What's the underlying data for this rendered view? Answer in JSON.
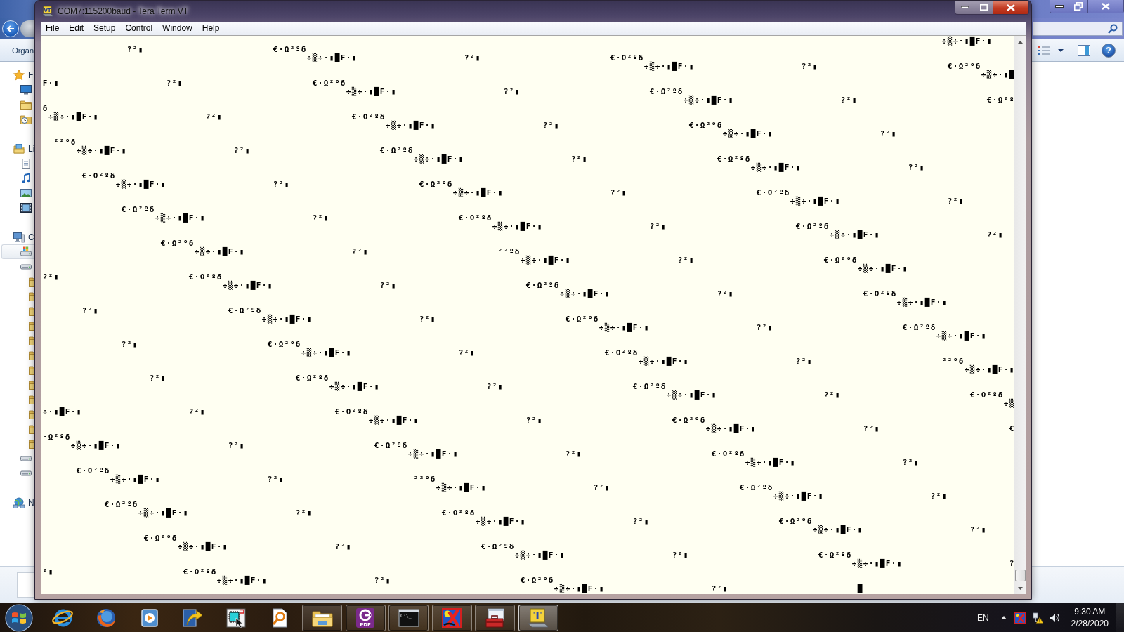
{
  "explorer": {
    "toolbar_label": "Organ",
    "help_text": "?",
    "nav": [
      {
        "label": "F",
        "children": [
          {
            "selected": false
          },
          {
            "selected": false
          },
          {
            "selected": false
          }
        ]
      },
      {
        "label": "Li",
        "children": [
          {
            "selected": false
          },
          {
            "selected": false
          },
          {
            "selected": false
          },
          {
            "selected": false
          }
        ]
      },
      {
        "label": "C",
        "children": [
          {
            "selected": true
          },
          {
            "selected": false,
            "children": [
              {
                "selected": false
              },
              {
                "selected": false
              },
              {
                "selected": false
              },
              {
                "selected": false
              },
              {
                "selected": false
              },
              {
                "selected": false
              },
              {
                "selected": false
              },
              {
                "selected": false
              },
              {
                "selected": false
              },
              {
                "selected": false
              },
              {
                "selected": false
              },
              {
                "selected": false
              }
            ]
          },
          {
            "selected": false
          },
          {
            "selected": false
          }
        ]
      },
      {
        "label": "N"
      }
    ]
  },
  "window": {
    "title": "COM7:115200baud - Tera Term VT",
    "icon_text": "VT",
    "menu": [
      "File",
      "Edit",
      "Setup",
      "Control",
      "Window",
      "Help"
    ]
  },
  "terminal": {
    "lines": [
      [
        "                                                                                                                                                                ÷▒÷·▮█F·▮"
      ],
      [
        "               ?²▮",
        "                       €·Ω²ºδ"
      ],
      [
        "                                               ÷▒÷·▮█F·▮",
        "                   ?²▮",
        "                       €·Ω²ºδ"
      ],
      [
        "                                                                                                           ÷▒÷·▮█F·▮",
        "                   ?²▮",
        "                       €·Ω²ºδ"
      ],
      [
        "                                                                                                                                                                       ÷▒÷·▮█"
      ],
      [
        "F·▮",
        "                   ?²▮",
        "                       €·Ω²ºδ"
      ],
      [
        "                                                      ÷▒÷·▮█F·▮",
        "                   ?²▮",
        "                       €·Ω²ºδ"
      ],
      [
        "                                                                                                                  ÷▒÷·▮█F·▮",
        "                   ?²▮",
        "                       €·Ω²º"
      ],
      [
        "δ"
      ],
      [
        " ÷▒÷·▮█F·▮",
        "                   ?²▮",
        "                       €·Ω²ºδ"
      ],
      [
        "                                                             ÷▒÷·▮█F·▮",
        "                   ?²▮",
        "                       €·Ω²ºδ"
      ],
      [
        "                                                                                                                         ÷▒÷·▮█F·▮",
        "                   ?²▮"
      ],
      [
        "  ²²ºδ"
      ],
      [
        "      ÷▒÷·▮█F·▮",
        "                   ?²▮",
        "                       €·Ω²ºδ"
      ],
      [
        "                                                                  ÷▒÷·▮█F·▮",
        "                   ?²▮",
        "                       €·Ω²ºδ"
      ],
      [
        "                                                                                                                              ÷▒÷·▮█F·▮",
        "                   ?²▮"
      ],
      [
        "       €·Ω²ºδ"
      ],
      [
        "             ÷▒÷·▮█F·▮",
        "                   ?²▮",
        "                       €·Ω²ºδ"
      ],
      [
        "                                                                         ÷▒÷·▮█F·▮",
        "                   ?²▮",
        "                       €·Ω²ºδ"
      ],
      [
        "                                                                                                                                     ÷▒÷·▮█F·▮",
        "                   ?²▮"
      ],
      [
        "              €·Ω²ºδ"
      ],
      [
        "                    ÷▒÷·▮█F·▮",
        "                   ?²▮",
        "                       €·Ω²ºδ"
      ],
      [
        "                                                                                ÷▒÷·▮█F·▮",
        "                   ?²▮",
        "                       €·Ω²ºδ"
      ],
      [
        "                                                                                                                                            ÷▒÷·▮█F·▮",
        "                   ?²▮"
      ],
      [
        "                     €·Ω²ºδ"
      ],
      [
        "                           ÷▒÷·▮█F·▮",
        "                   ?²▮",
        "                       ²²ºδ"
      ],
      [
        "                                                                                     ÷▒÷·▮█F·▮",
        "                   ?²▮",
        "                       €·Ω²ºδ"
      ],
      [
        "                                                                                                                                                 ÷▒÷·▮█F·▮"
      ],
      [
        "?²▮",
        "                       €·Ω²ºδ"
      ],
      [
        "                                ÷▒÷·▮█F·▮",
        "                   ?²▮",
        "                       €·Ω²ºδ"
      ],
      [
        "                                                                                            ÷▒÷·▮█F·▮",
        "                   ?²▮",
        "                       €·Ω²ºδ"
      ],
      [
        "                                                                                                                                                        ÷▒÷·▮█F·▮"
      ],
      [
        "       ?²▮",
        "                       €·Ω²ºδ"
      ],
      [
        "                                       ÷▒÷·▮█F·▮",
        "                   ?²▮",
        "                       €·Ω²ºδ"
      ],
      [
        "                                                                                                   ÷▒÷·▮█F·▮",
        "                   ?²▮",
        "                       €·Ω²ºδ"
      ],
      [
        "                                                                                                                                                               ÷▒÷·▮█F·▮"
      ],
      [
        "              ?²▮",
        "                       €·Ω²ºδ"
      ],
      [
        "                                              ÷▒÷·▮█F·▮",
        "                   ?²▮",
        "                       €·Ω²ºδ"
      ],
      [
        "                                                                                                          ÷▒÷·▮█F·▮",
        "                   ?²▮",
        "                       ²²ºδ"
      ],
      [
        "                                                                                                                                                                    ÷▒÷·▮█F·▮"
      ],
      [
        "                   ?²▮",
        "                       €·Ω²ºδ"
      ],
      [
        "                                                   ÷▒÷·▮█F·▮",
        "                   ?²▮",
        "                       €·Ω²ºδ"
      ],
      [
        "                                                                                                               ÷▒÷·▮█F·▮",
        "                   ?²▮",
        "                       €·Ω²ºδ"
      ],
      [
        "                                                                                                                                                                           ÷▒"
      ],
      [
        "÷·▮█F·▮",
        "                   ?²▮",
        "                       €·Ω²ºδ"
      ],
      [
        "                                                          ÷▒÷·▮█F·▮",
        "                   ?²▮",
        "                       €·Ω²ºδ"
      ],
      [
        "                                                                                                                      ÷▒÷·▮█F·▮",
        "                   ?²▮",
        "                       €"
      ],
      [
        "·Ω²ºδ"
      ],
      [
        "     ÷▒÷·▮█F·▮",
        "                   ?²▮",
        "                       €·Ω²ºδ"
      ],
      [
        "                                                                 ÷▒÷·▮█F·▮",
        "                   ?²▮",
        "                       €·Ω²ºδ"
      ],
      [
        "                                                                                                                             ÷▒÷·▮█F·▮",
        "                   ?²▮"
      ],
      [
        "      €·Ω²ºδ"
      ],
      [
        "            ÷▒÷·▮█F·▮",
        "                   ?²▮",
        "                       ²²ºδ"
      ],
      [
        "                                                                      ÷▒÷·▮█F·▮",
        "                   ?²▮",
        "                       €·Ω²ºδ"
      ],
      [
        "                                                                                                                                  ÷▒÷·▮█F·▮",
        "                   ?²▮"
      ],
      [
        "           €·Ω²ºδ"
      ],
      [
        "                 ÷▒÷·▮█F·▮",
        "                   ?²▮",
        "                       €·Ω²ºδ"
      ],
      [
        "                                                                             ÷▒÷·▮█F·▮",
        "                   ?²▮",
        "                       €·Ω²ºδ"
      ],
      [
        "                                                                                                                                         ÷▒÷·▮█F·▮",
        "                   ?²▮"
      ],
      [
        "                  €·Ω²ºδ"
      ],
      [
        "                        ÷▒÷·▮█F·▮",
        "                   ?²▮",
        "                       €·Ω²ºδ"
      ],
      [
        "                                                                                    ÷▒÷·▮█F·▮",
        "                   ?²▮",
        "                       €·Ω²ºδ"
      ],
      [
        "                                                                                                                                                ÷▒÷·▮█F·▮",
        "                   ?"
      ],
      [
        "²▮",
        "                       €·Ω²ºδ"
      ],
      [
        "                               ÷▒÷·▮█F·▮",
        "                   ?²▮",
        "                       €·Ω²ºδ"
      ],
      [
        "                                                                                           ÷▒÷·▮█F·▮",
        "                   ?²▮",
        "                       █"
      ]
    ]
  },
  "taskbar": {
    "buttons": [
      {
        "running": false,
        "selected": false
      },
      {
        "running": false,
        "selected": false
      },
      {
        "running": false,
        "selected": false
      },
      {
        "running": false,
        "selected": false
      },
      {
        "running": false,
        "selected": false
      },
      {
        "running": false,
        "selected": false
      },
      {
        "running": true,
        "selected": false
      },
      {
        "running": true,
        "selected": false,
        "icon_text": "PDF"
      },
      {
        "running": true,
        "selected": false,
        "icon_text": "C:\\_"
      },
      {
        "running": true,
        "selected": false
      },
      {
        "running": true,
        "selected": false
      },
      {
        "running": true,
        "selected": true,
        "icon_text": "T"
      }
    ],
    "tray": {
      "language": "EN",
      "time": "9:30 AM",
      "date": "2/28/2020"
    }
  }
}
